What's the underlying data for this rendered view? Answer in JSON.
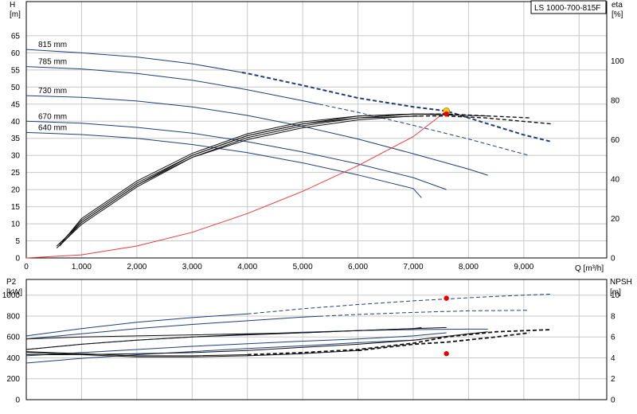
{
  "chart_data": [
    {
      "type": "line",
      "title": "LS 1000-700-815F",
      "xlabel": "Q [m³/h]",
      "ylabel_main": "H",
      "ylabel_unit": "[m]",
      "y2label_main": "eta",
      "y2label_unit": "[%]",
      "xlim": [
        0,
        10500
      ],
      "ylim": [
        0,
        75
      ],
      "y2lim": [
        0,
        130
      ],
      "xticks": [
        0,
        1000,
        2000,
        3000,
        4000,
        5000,
        6000,
        7000,
        8000,
        9000
      ],
      "xtick_labels": [
        "0",
        "1,000",
        "2,000",
        "3,000",
        "4,000",
        "5,000",
        "6,000",
        "7,000",
        "8,000",
        "9,000"
      ],
      "yticks": [
        0,
        5,
        10,
        15,
        20,
        25,
        30,
        35,
        40,
        45,
        50,
        55,
        60,
        65
      ],
      "y2ticks": [
        0,
        20,
        40,
        60,
        80,
        100
      ],
      "grid": true,
      "head_curves": [
        {
          "name": "815 mm",
          "x": [
            0,
            1000,
            2000,
            3000,
            4000,
            5000,
            6000,
            7000,
            7600,
            8200,
            9000,
            9500
          ],
          "y": [
            61,
            60,
            58.8,
            56.8,
            54,
            50.5,
            46.8,
            44.2,
            43,
            40,
            36,
            34
          ],
          "dashed_from": 3900,
          "color": "#1f3f7a",
          "bold": true
        },
        {
          "name": "785 mm",
          "x": [
            0,
            1000,
            2000,
            3000,
            4000,
            5000,
            6000,
            7000,
            8000,
            9000,
            9100
          ],
          "y": [
            56,
            55.3,
            54,
            52,
            49.2,
            46,
            42.6,
            38.8,
            34.8,
            30.4,
            30
          ],
          "dashed_from": 5300,
          "color": "#1f3f7a"
        },
        {
          "name": "730 mm",
          "x": [
            0,
            1000,
            2000,
            3000,
            4000,
            5000,
            6000,
            7000,
            8000,
            8350
          ],
          "y": [
            47.5,
            47,
            45.9,
            44.2,
            41.7,
            38.5,
            34.8,
            30.5,
            26,
            24.2
          ],
          "color": "#1f3f7a"
        },
        {
          "name": "670 mm",
          "x": [
            0,
            1000,
            2000,
            3000,
            4000,
            5000,
            6000,
            7000,
            7600
          ],
          "y": [
            40,
            39.4,
            38.2,
            36.5,
            34,
            31,
            27.5,
            23.5,
            20
          ],
          "color": "#1f3f7a"
        },
        {
          "name": "640 mm",
          "x": [
            0,
            1000,
            2000,
            3000,
            4000,
            5000,
            6000,
            7000,
            7150
          ],
          "y": [
            36.7,
            36.1,
            35,
            33.2,
            30.8,
            27.8,
            24.3,
            20.3,
            17.6
          ],
          "color": "#1f3f7a"
        }
      ],
      "system_curve": {
        "x": [
          0,
          1000,
          2000,
          3000,
          4000,
          5000,
          6000,
          7000,
          7600
        ],
        "y": [
          0,
          0.9,
          3.5,
          7.5,
          13,
          19.5,
          27,
          35.5,
          43
        ],
        "color": "#e83a3a"
      },
      "eta_curves": [
        {
          "x": [
            550,
            1000,
            2000,
            3000,
            4000,
            5000,
            6000,
            7000,
            7600,
            8300,
            9500
          ],
          "y": [
            6,
            18,
            37,
            51,
            60,
            66,
            70,
            72,
            72,
            71,
            68
          ],
          "dashed_from": 7000
        },
        {
          "x": [
            600,
            1000,
            2000,
            3000,
            4000,
            5000,
            6000,
            7000,
            7500
          ],
          "y": [
            7,
            19,
            38,
            52,
            62,
            68,
            72,
            73,
            73
          ]
        },
        {
          "x": [
            650,
            1000,
            2000,
            3000,
            4000,
            5000,
            6000,
            7000,
            7600,
            9100
          ],
          "y": [
            8,
            20,
            39,
            53,
            63,
            69,
            72,
            73,
            73,
            71
          ],
          "dashed_from": 7300
        },
        {
          "x": [
            550,
            1000,
            2000,
            3000,
            4000,
            5000,
            6000,
            7000,
            8350
          ],
          "y": [
            5,
            17,
            36,
            51,
            61,
            67,
            71,
            73,
            72
          ]
        },
        {
          "x": [
            600,
            1000,
            2000,
            3000,
            4000,
            5000,
            6000,
            7150
          ],
          "y": [
            6,
            18,
            37,
            52,
            62,
            68,
            71,
            72
          ]
        }
      ],
      "operating_point": {
        "x": 7600,
        "y": 43,
        "color": "#ffc61a"
      },
      "eta_point": {
        "x": 7600,
        "y": 73,
        "color": "#e60000"
      }
    },
    {
      "type": "line",
      "xlabel": "",
      "ylabel_main": "P2",
      "ylabel_unit": "[kW]",
      "y2label_main": "NPSH",
      "y2label_unit": "[m]",
      "xlim": [
        0,
        10500
      ],
      "ylim": [
        0,
        1150
      ],
      "y2lim": [
        0,
        11.5
      ],
      "yticks": [
        0,
        200,
        400,
        600,
        800,
        1000
      ],
      "y2ticks": [
        0,
        2,
        4,
        6,
        8,
        10
      ],
      "grid": true,
      "power_curves": [
        {
          "x": [
            0,
            1000,
            2000,
            3000,
            4000,
            5000,
            6000,
            7000,
            8000,
            9000,
            9500
          ],
          "y": [
            610,
            680,
            740,
            785,
            820,
            870,
            910,
            945,
            975,
            1000,
            1010
          ],
          "dashed_from": 4000,
          "color": "#1f3f7a"
        },
        {
          "x": [
            0,
            1000,
            2000,
            3000,
            4000,
            5000,
            6000,
            7000,
            8000,
            9100
          ],
          "y": [
            580,
            630,
            680,
            720,
            755,
            790,
            815,
            835,
            850,
            855
          ],
          "dashed_from": 5300,
          "color": "#1f3f7a"
        },
        {
          "x": [
            0,
            1000,
            2000,
            3000,
            4000,
            5000,
            6000,
            7000,
            8000,
            8350
          ],
          "y": [
            480,
            530,
            570,
            600,
            625,
            645,
            660,
            670,
            675,
            675
          ],
          "color": "#1f3f7a"
        },
        {
          "x": [
            0,
            1000,
            2000,
            3000,
            4000,
            5000,
            6000,
            7000,
            7600
          ],
          "y": [
            420,
            450,
            480,
            510,
            535,
            560,
            580,
            610,
            640
          ],
          "color": "#1f3f7a"
        },
        {
          "x": [
            0,
            1000,
            2000,
            3000,
            4000,
            5000,
            6000,
            7000,
            7150
          ],
          "y": [
            350,
            395,
            430,
            460,
            490,
            515,
            545,
            570,
            575
          ],
          "color": "#1f3f7a"
        }
      ],
      "npsh_curves": [
        {
          "x": [
            0,
            1000,
            2000,
            3000,
            4000,
            5000,
            6000,
            7000,
            7600,
            8500,
            9500
          ],
          "y": [
            4.6,
            4.4,
            4.2,
            4.2,
            4.3,
            4.5,
            4.8,
            5.4,
            6,
            6.5,
            6.7
          ],
          "dashed_from": 4000
        },
        {
          "x": [
            0,
            1000,
            2000,
            3000,
            4000,
            5000,
            6000,
            7000,
            7600,
            8500,
            9100
          ],
          "y": [
            4.5,
            4.3,
            4.1,
            4.1,
            4.2,
            4.4,
            4.7,
            5.3,
            5.5,
            6,
            6.4
          ],
          "dashed_from": 6000
        },
        {
          "x": [
            0,
            1000,
            2000,
            3000,
            4000,
            5000,
            6000,
            7000,
            8000,
            8350
          ],
          "y": [
            4.3,
            4.3,
            4.4,
            4.5,
            4.7,
            5,
            5.3,
            5.7,
            6.3,
            6.5
          ]
        },
        {
          "x": [
            0,
            1000,
            2000,
            3000,
            4000,
            5000,
            6000,
            7000,
            7600
          ],
          "y": [
            5.8,
            6,
            6.1,
            6.2,
            6.3,
            6.4,
            6.6,
            6.8,
            6.9
          ]
        },
        {
          "x": [
            0,
            1000,
            2000,
            3000,
            4000,
            5000,
            6000,
            7000,
            7150
          ],
          "y": [
            4.8,
            5.3,
            5.7,
            6,
            6.2,
            6.4,
            6.6,
            6.8,
            6.9
          ]
        }
      ],
      "power_point": {
        "x": 7600,
        "y": 970,
        "color": "#e60000"
      },
      "npsh_point": {
        "x": 7600,
        "y": 4.4,
        "color": "#e60000"
      }
    }
  ]
}
